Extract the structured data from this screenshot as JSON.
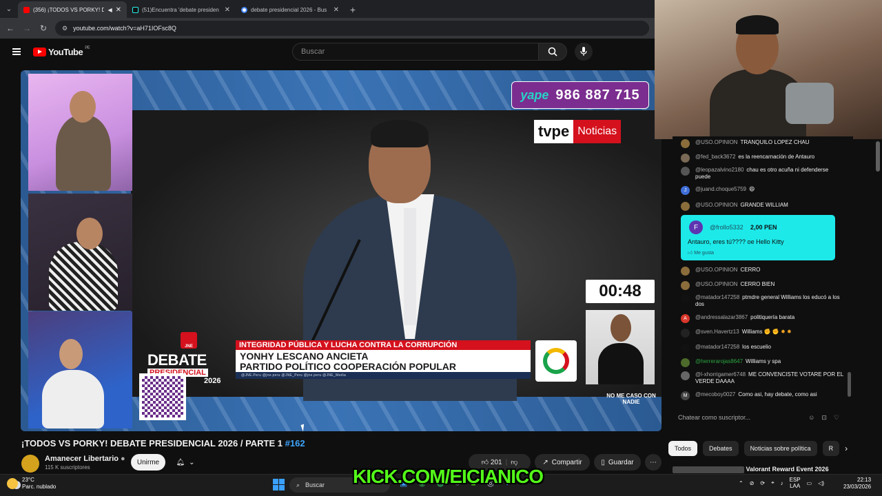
{
  "browser": {
    "tabs": [
      {
        "title": "(356) ¡TODOS VS PORKY! D",
        "icon": "youtube-icon",
        "active": true
      },
      {
        "title": "(51)Encuentra 'debate presiden",
        "icon": "tiktok-icon",
        "active": false
      },
      {
        "title": "debate presidencial 2026 - Bus",
        "icon": "google-icon",
        "active": false
      }
    ],
    "url": "youtube.com/watch?v=aH71IOFsc8Q"
  },
  "youtube": {
    "logo_text": "YouTube",
    "country": "PE",
    "search_placeholder": "Buscar"
  },
  "video": {
    "yape_brand": "yape",
    "yape_number": "986 887 715",
    "channel_tv": "tvpe",
    "channel_news": "Noticias",
    "timer": "00:48",
    "category": "INTEGRIDAD PÚBLICA Y LUCHA CONTRA LA CORRUPCIÓN",
    "candidate": "YONHY LESCANO ANCIETA",
    "party": "PARTIDO POLÍTICO COOPERACIÓN POPULAR",
    "handles": "@JNE.Peru   @jne.peru   @JNE_Peru   @jne.peru   @JNE_Media",
    "jne": "JNE",
    "debate_word": "DEBATE",
    "debate_sub": "PRESIDENCIAL",
    "debate_year": "2026",
    "badge_text": "NO ME CASO CON NADIE",
    "title": "¡TODOS VS PORKY! DEBATE PRESIDENCIAL 2026 / PARTE 1",
    "title_tag": "#162",
    "channel_name": "Amanecer Libertario",
    "subscribers": "115 K suscriptores",
    "join_label": "Unirme",
    "likes": "201",
    "share_label": "Compartir",
    "save_label": "Guardar"
  },
  "chat": {
    "messages": [
      {
        "author": "@USO.OPINION",
        "text": "TRANQUILO LOPEZ CHAU",
        "avatar_color": "#8a6d3b",
        "initial": ""
      },
      {
        "author": "@fed_back3672",
        "text": "es la reencarnación de Antauro",
        "avatar_color": "#7a6a55",
        "initial": ""
      },
      {
        "author": "@leopazalvino2180",
        "text": "chau es otro acuña ni defenderse puede",
        "avatar_color": "#555",
        "initial": ""
      },
      {
        "author": "@juand.choque5759",
        "text": "",
        "avatar_color": "#3f6fd8",
        "initial": "J"
      },
      {
        "author": "@USO.OPINION",
        "text": "GRANDE WILLIAM",
        "avatar_color": "#8a6d3b",
        "initial": ""
      },
      {
        "author": "@USO.OPINION",
        "text": "CERRO",
        "avatar_color": "#8a6d3b",
        "initial": ""
      },
      {
        "author": "@USO.OPINION",
        "text": "CERRO BIEN",
        "avatar_color": "#8a6d3b",
        "initial": ""
      },
      {
        "author": "@matador147258",
        "text": "ptmdre general Williams los educó a los dos",
        "avatar_color": "#111",
        "initial": ""
      },
      {
        "author": "@andressalazar3867",
        "text": "politiquería barata",
        "avatar_color": "#d9362b",
        "initial": "A"
      },
      {
        "author": "@sven.Havertz13",
        "text": "Williams",
        "avatar_color": "#222",
        "initial": ""
      },
      {
        "author": "@matador147258",
        "text": "los escuelio",
        "avatar_color": "#111",
        "initial": ""
      },
      {
        "author": "@herrerarojas8647",
        "text": "Williams y spa",
        "avatar_color": "#4d6b2a",
        "initial": ""
      },
      {
        "author": "@l-xhorrigamer6748",
        "text": "ME CONVENCISTE VOTARE POR EL VERDE DAAAA",
        "avatar_color": "#666",
        "initial": ""
      },
      {
        "author": "@mecoboy0027",
        "text": "Como asi, hay debate, como asi",
        "avatar_color": "#444",
        "initial": "M"
      }
    ],
    "superchat": {
      "initial": "F",
      "author": "@frollo5332",
      "amount": "2,00 PEN",
      "text": "Antauro, eres tú???? oe Hello Kitty",
      "like_label": "Me gusta"
    },
    "input_placeholder": "Chatear como suscriptor...",
    "chips": [
      "Todos",
      "Debates",
      "Noticias sobre política",
      "R"
    ],
    "recommended_title": "Valorant Reward Event 2026"
  },
  "taskbar": {
    "temperature": "23°C",
    "weather": "Parc. nublado",
    "search_label": "Buscar",
    "overlay_text": "KICK.COM/EICIANICO",
    "lang": "ESP",
    "region": "LAA",
    "time": "22:13",
    "date": "23/03/2026"
  }
}
